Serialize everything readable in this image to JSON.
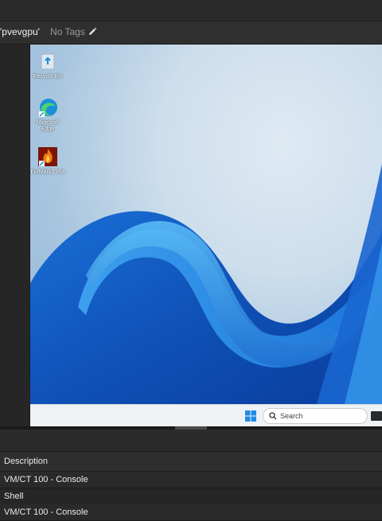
{
  "header": {
    "vm_name": "'pvevgpu'",
    "tags_label": "No Tags",
    "edit_icon": "pencil-icon"
  },
  "desktop": {
    "icons": [
      {
        "label": "Recycle Bin",
        "icon": "recycle-bin-icon"
      },
      {
        "label": "Microsoft Edge",
        "icon": "edge-icon"
      },
      {
        "label": "FurMark2 x64",
        "icon": "furmark-icon"
      }
    ],
    "taskbar": {
      "start_icon": "windows-start-icon",
      "search_placeholder": "Search",
      "search_icon": "search-icon"
    }
  },
  "tasks": {
    "columns": [
      "Description"
    ],
    "rows": [
      "VM/CT 100 - Console",
      "Shell",
      "VM/CT 100 - Console"
    ]
  }
}
